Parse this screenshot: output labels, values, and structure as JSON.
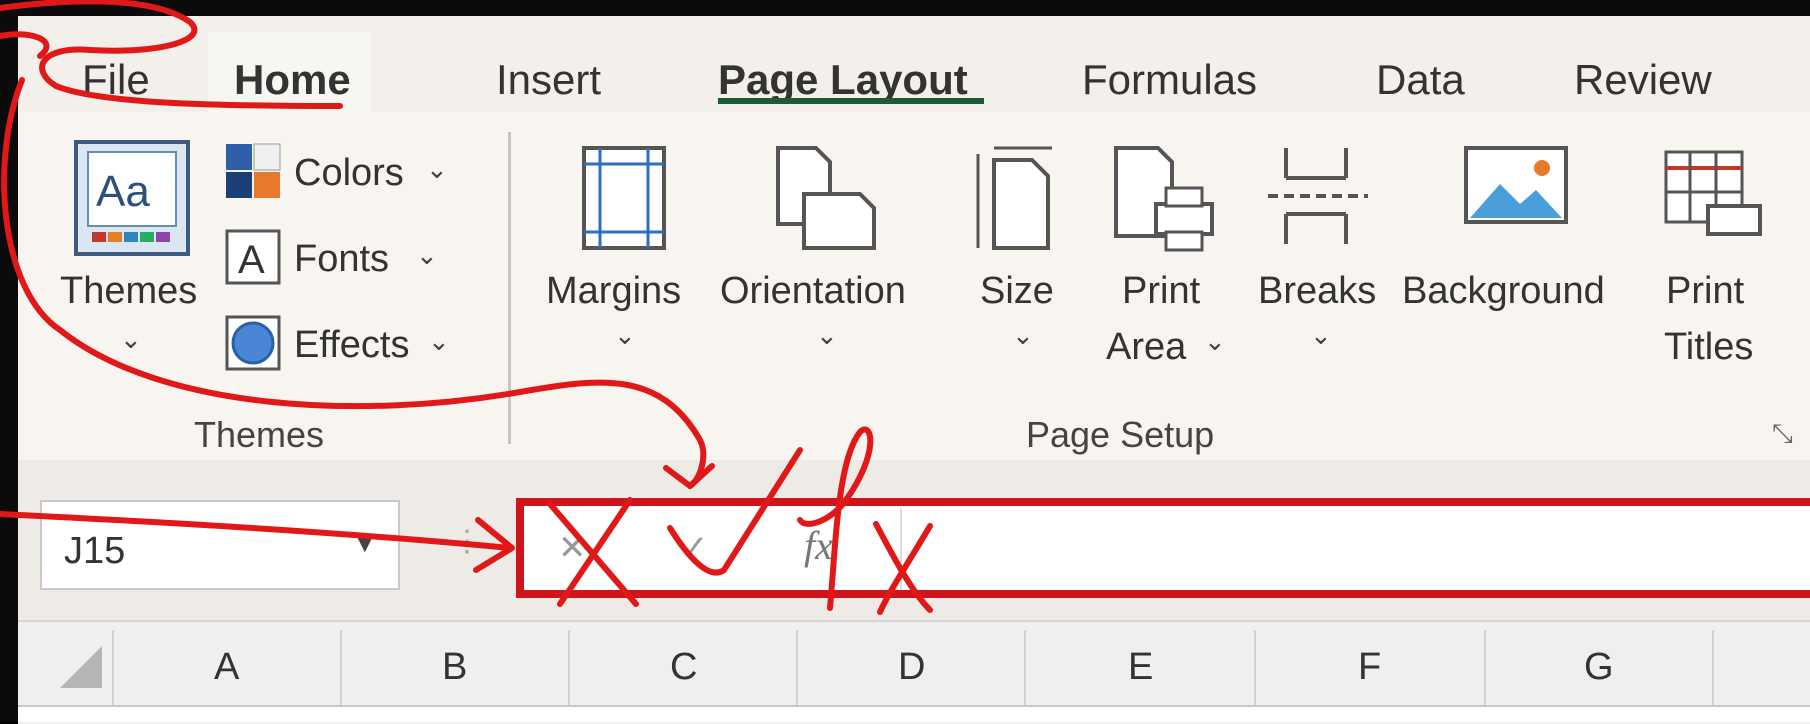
{
  "tabs": [
    "File",
    "Home",
    "Insert",
    "Page Layout",
    "Formulas",
    "Data",
    "Review"
  ],
  "active_tab": "Page Layout",
  "themes_group": {
    "themes_label": "Themes",
    "colors_label": "Colors",
    "fonts_label": "Fonts",
    "effects_label": "Effects",
    "group_label": "Themes"
  },
  "page_setup": {
    "margins": "Margins",
    "orientation": "Orientation",
    "size": "Size",
    "print": "Print",
    "area": "Area",
    "breaks": "Breaks",
    "background": "Background",
    "print2": "Print",
    "titles": "Titles",
    "group_label": "Page Setup"
  },
  "formula_bar": {
    "name_box": "J15",
    "cancel": "✕",
    "enter": "✓",
    "fx": "fx",
    "value": ""
  },
  "columns": [
    "A",
    "B",
    "C",
    "D",
    "E",
    "F",
    "G"
  ],
  "colors": {
    "annotation": "#e01818",
    "active_tab_underline": "#1e5a33"
  }
}
